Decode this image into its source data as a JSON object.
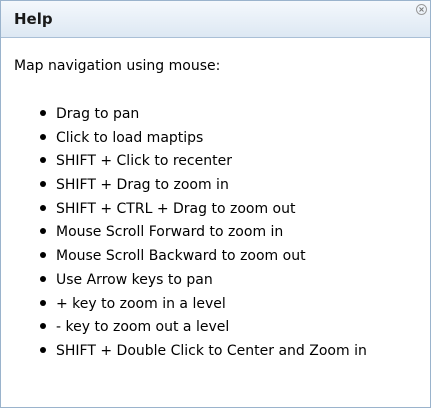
{
  "panel": {
    "title": "Help",
    "close_icon": "close-circle-icon"
  },
  "body": {
    "intro": "Map navigation using mouse:",
    "items": [
      "Drag to pan",
      "Click to load maptips",
      "SHIFT + Click to recenter",
      "SHIFT + Drag to zoom in",
      "SHIFT + CTRL + Drag to zoom out",
      "Mouse Scroll Forward to zoom in",
      "Mouse Scroll Backward to zoom out",
      "Use Arrow keys to pan",
      "+ key to zoom in a level",
      "- key to zoom out a level",
      "SHIFT + Double Click to Center and Zoom in"
    ]
  }
}
